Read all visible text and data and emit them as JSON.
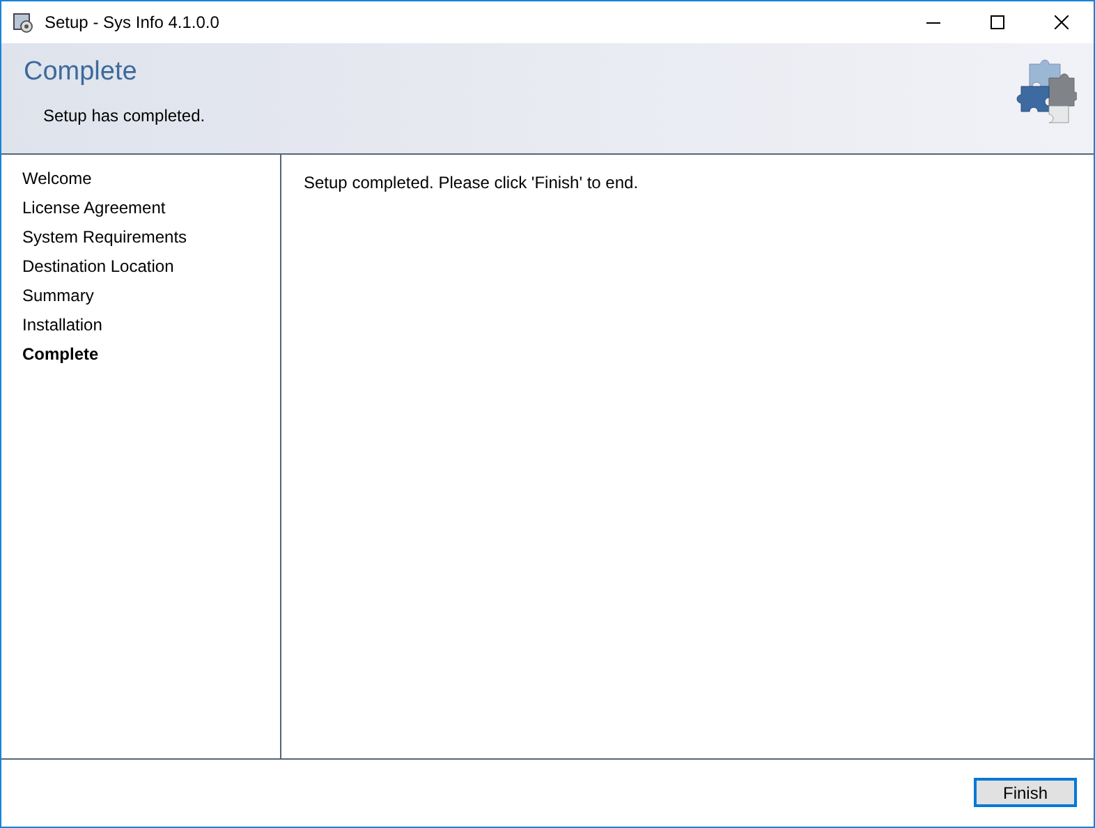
{
  "window": {
    "title": "Setup - Sys Info 4.1.0.0"
  },
  "header": {
    "title": "Complete",
    "subtitle": "Setup has completed."
  },
  "steps": [
    {
      "label": "Welcome",
      "selected": false
    },
    {
      "label": "License Agreement",
      "selected": false
    },
    {
      "label": "System Requirements",
      "selected": false
    },
    {
      "label": "Destination Location",
      "selected": false
    },
    {
      "label": "Summary",
      "selected": false
    },
    {
      "label": "Installation",
      "selected": false
    },
    {
      "label": "Complete",
      "selected": true
    }
  ],
  "content": {
    "message": "Setup completed. Please click 'Finish' to end."
  },
  "buttons": [
    {
      "label": "Finish",
      "focused": true
    }
  ]
}
